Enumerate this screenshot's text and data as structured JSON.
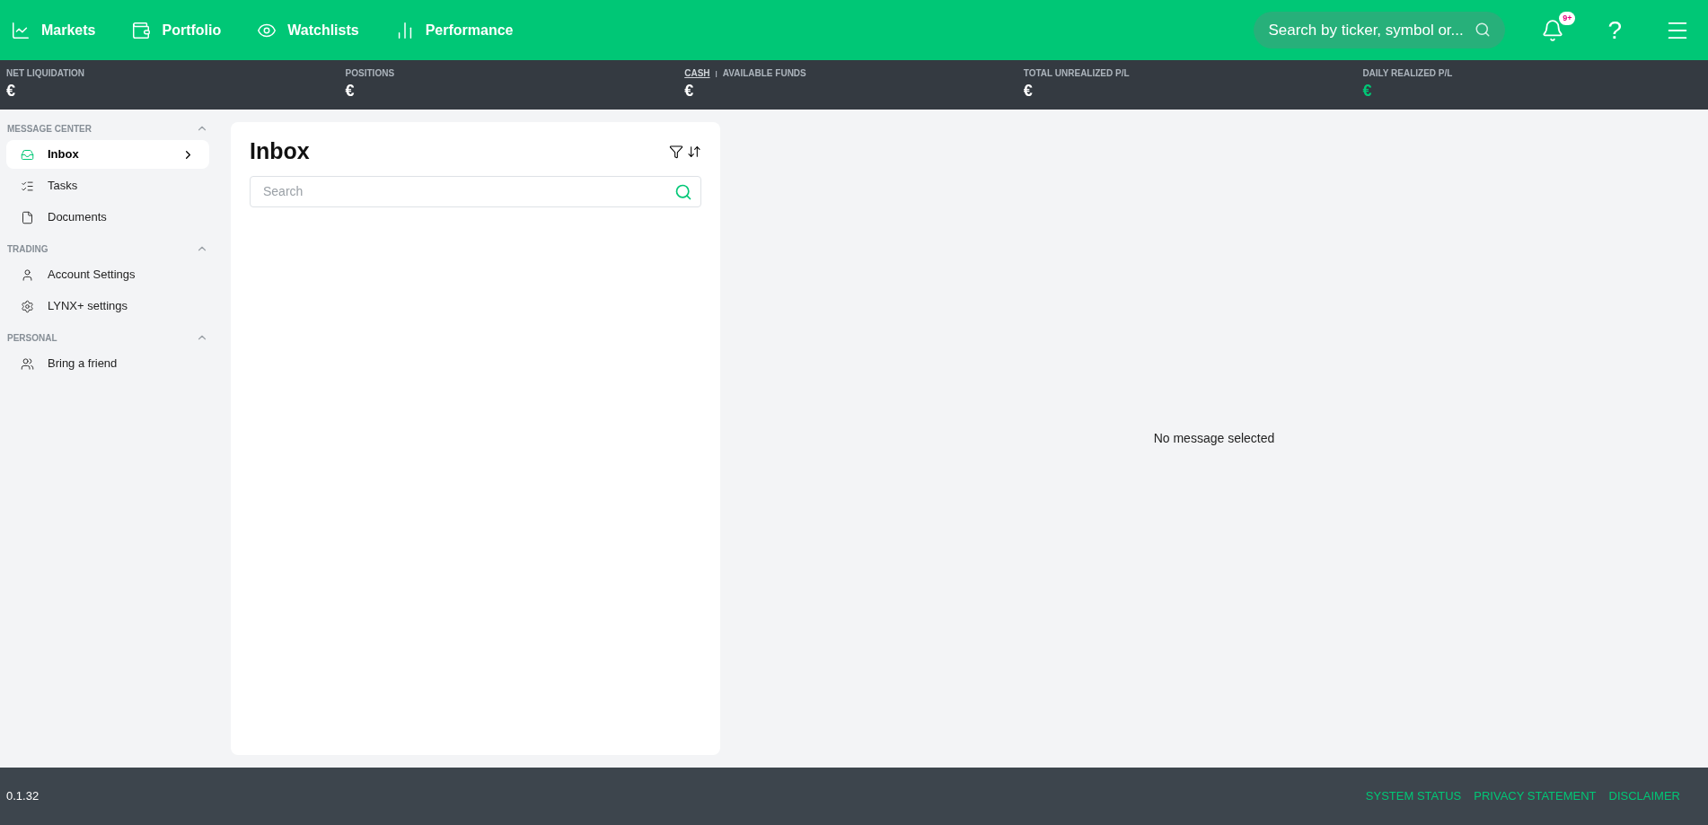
{
  "nav": {
    "items": [
      {
        "label": "Markets"
      },
      {
        "label": "Portfolio"
      },
      {
        "label": "Watchlists"
      },
      {
        "label": "Performance"
      }
    ],
    "search": {
      "placeholder": "Search by ticker, symbol or..."
    },
    "notifications": {
      "badge": "9+"
    },
    "help": "?"
  },
  "stats": [
    {
      "label": "NET LIQUIDATION",
      "value": "€",
      "color": "#ffffff"
    },
    {
      "label": "POSITIONS",
      "value": "€",
      "color": "#ffffff"
    },
    {
      "options": [
        {
          "label": "CASH",
          "selected": true
        },
        {
          "label": "AVAILABLE FUNDS",
          "selected": false
        }
      ],
      "separator": "|",
      "value": "€",
      "color": "#ffffff"
    },
    {
      "label": "TOTAL UNREALIZED P/L",
      "value": "€",
      "color": "#ffffff"
    },
    {
      "label": "DAILY REALIZED P/L",
      "value": "€",
      "color": "#00c776"
    }
  ],
  "sidebar": {
    "sections": [
      {
        "title": "MESSAGE CENTER",
        "expanded": true,
        "items": [
          {
            "label": "Inbox",
            "selected": true
          },
          {
            "label": "Tasks",
            "selected": false
          },
          {
            "label": "Documents",
            "selected": false
          }
        ]
      },
      {
        "title": "TRADING",
        "expanded": true,
        "items": [
          {
            "label": "Account Settings",
            "selected": false
          },
          {
            "label": "LYNX+ settings",
            "selected": false
          }
        ]
      },
      {
        "title": "PERSONAL",
        "expanded": true,
        "items": [
          {
            "label": "Bring a friend",
            "selected": false
          }
        ]
      }
    ]
  },
  "inbox": {
    "title": "Inbox",
    "search": {
      "placeholder": "Search"
    }
  },
  "detail": {
    "empty_text": "No message selected"
  },
  "footer": {
    "version": "0.1.32",
    "links": [
      "SYSTEM STATUS",
      "PRIVACY STATEMENT",
      "DISCLAIMER"
    ]
  }
}
